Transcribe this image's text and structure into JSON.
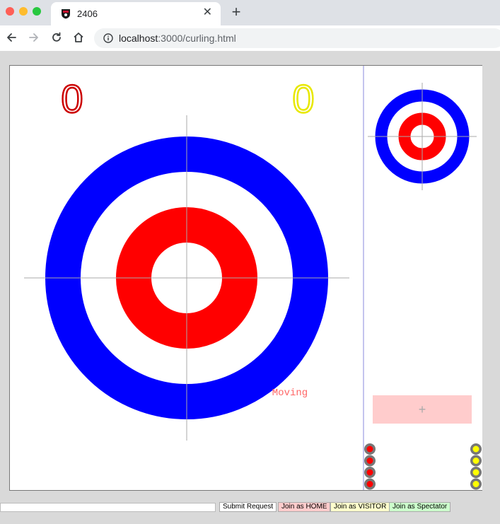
{
  "browser": {
    "tab_title": "2406",
    "close_glyph": "✕",
    "new_tab_glyph": "+",
    "url_host": "localhost",
    "url_rest": ":3000/curling.html"
  },
  "game": {
    "score_home": "0",
    "score_visitor": "0",
    "status_text": "Moving",
    "home_color": "#ff0000",
    "visitor_color": "#ffff00",
    "outer_ring_color": "#0000ff",
    "inner_ring_color": "#ff0000",
    "home_stones_remaining": 4,
    "visitor_stones_remaining": 4,
    "launch_pad_glyph": "+"
  },
  "controls": {
    "input_value": "",
    "submit_label": "Submit Request",
    "join_home_label": "Join as HOME",
    "join_visitor_label": "Join as VISITOR",
    "join_spectator_label": "Join as Spectator",
    "join_home_color": "#ffcccc",
    "join_visitor_color": "#ffffcc",
    "join_spectator_color": "#ccffcc"
  }
}
